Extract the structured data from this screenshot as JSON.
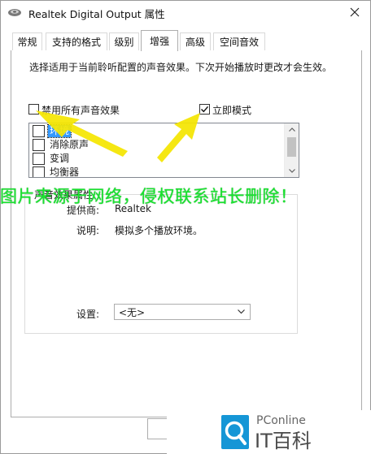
{
  "window": {
    "title": "Realtek Digital Output 属性",
    "close_icon": "close-icon",
    "app_icon": "speaker-icon"
  },
  "tabs": [
    {
      "label": "常规",
      "active": false
    },
    {
      "label": "支持的格式",
      "active": false
    },
    {
      "label": "级别",
      "active": false
    },
    {
      "label": "增强",
      "active": true
    },
    {
      "label": "高级",
      "active": false
    },
    {
      "label": "空间音效",
      "active": false
    }
  ],
  "enhancements": {
    "description": "选择适用于当前聆听配置的声音效果。下次开始播放时更改才会生效。",
    "disable_all": {
      "label": "禁用所有声音效果",
      "checked": false
    },
    "immediate_mode": {
      "label": "立即模式",
      "checked": true
    },
    "effects": [
      {
        "label": "环境",
        "checked": false,
        "selected": true
      },
      {
        "label": "消除原声",
        "checked": false,
        "selected": false
      },
      {
        "label": "变调",
        "checked": false,
        "selected": false
      },
      {
        "label": "均衡器",
        "checked": false,
        "selected": false
      }
    ],
    "properties": {
      "legend": "声音效果属性",
      "provider_label": "提供商:",
      "provider_value": "Realtek",
      "description_label": "说明:",
      "description_value": "模拟多个播放环境。",
      "setting_label": "设置:",
      "setting_value": "<无>"
    }
  },
  "overlay": {
    "watermark": "图片来源于网络，侵权联系站长删除！",
    "brand_pconline": "PConline",
    "brand_cn": "IT百科",
    "arrow_color": "#f5e600",
    "watermark_color": "#18e42f"
  }
}
